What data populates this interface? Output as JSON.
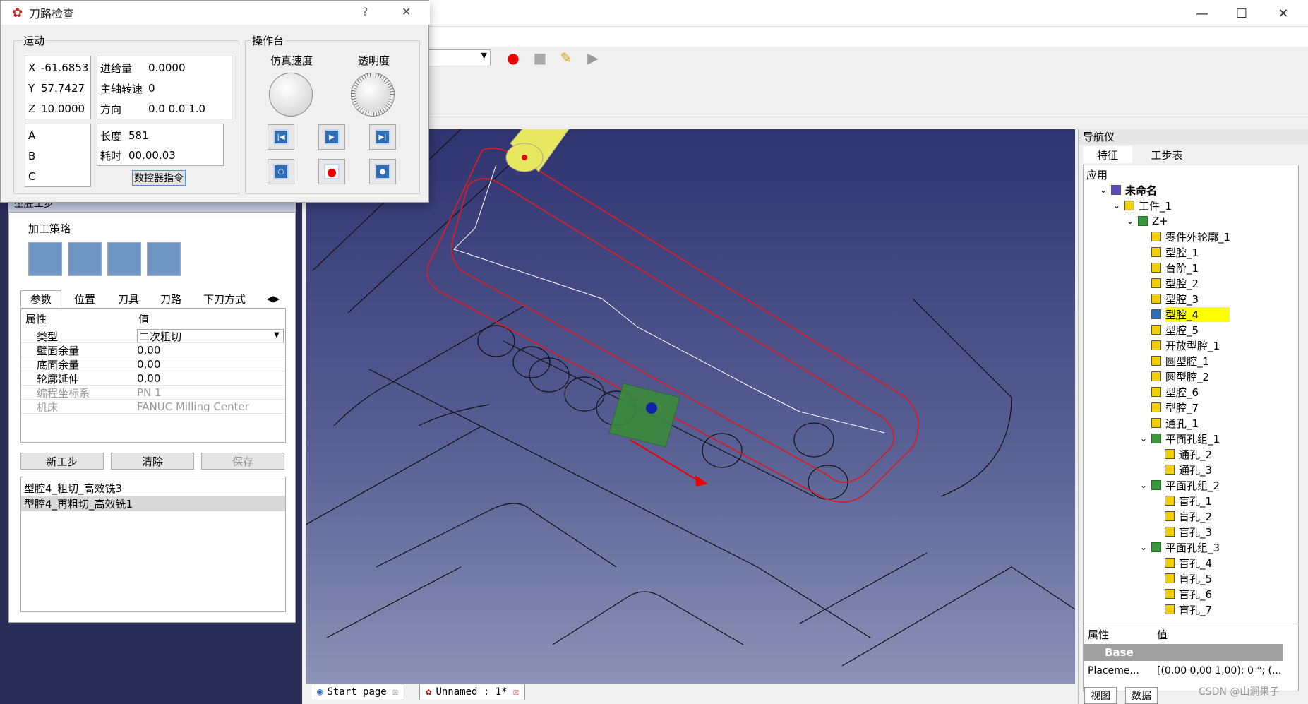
{
  "dialog": {
    "title": "刀路检查",
    "help": "?",
    "close": "✕",
    "motion": {
      "group_label": "运动",
      "x_label": "X",
      "x_value": "-61.6853",
      "y_label": "Y",
      "y_value": "57.7427",
      "z_label": "Z",
      "z_value": "10.0000",
      "a_label": "A",
      "b_label": "B",
      "c_label": "C",
      "feed_label": "进给量",
      "feed_value": "0.0000",
      "spindle_label": "主轴转速",
      "spindle_value": "0",
      "dir_label": "方向",
      "dir_value": "0.0 0.0 1.0",
      "length_label": "长度",
      "length_value": "581",
      "time_label": "耗时",
      "time_value": "00.00.03",
      "nc_button": "数控器指令"
    },
    "console": {
      "group_label": "操作台",
      "speed_label": "仿真速度",
      "opacity_label": "透明度"
    }
  },
  "window": {
    "minimize": "—",
    "maximize": "☐",
    "close": "✕"
  },
  "left_panel": {
    "header": "型腔工步",
    "strategy_label": "加工策略",
    "tabs": [
      "参数",
      "位置",
      "刀具",
      "刀路",
      "下刀方式"
    ],
    "prop_header": "属性",
    "value_header": "值",
    "props": [
      {
        "name": "类型",
        "value": "二次粗切",
        "disabled": false
      },
      {
        "name": "壁面余量",
        "value": "0,00",
        "disabled": false
      },
      {
        "name": "底面余量",
        "value": "0,00",
        "disabled": false
      },
      {
        "name": "轮廓延伸",
        "value": "0,00",
        "disabled": false
      },
      {
        "name": "编程坐标系",
        "value": "PN 1",
        "disabled": true
      },
      {
        "name": "机床",
        "value": "FANUC Milling Center",
        "disabled": true
      }
    ],
    "new_button": "新工步",
    "clear_button": "清除",
    "save_button": "保存",
    "steps": [
      "型腔4_粗切_高效铣3",
      "型腔4_再粗切_高效铣1"
    ]
  },
  "navigator": {
    "title": "导航仪",
    "tab_feature": "特征",
    "tab_steps": "工步表",
    "tree": [
      {
        "label": "应用",
        "level": 0,
        "arrow": ""
      },
      {
        "label": "未命名",
        "level": 1,
        "arrow": "v"
      },
      {
        "label": "工件_1",
        "level": 2,
        "arrow": "v"
      },
      {
        "label": "Z+",
        "level": 3,
        "arrow": "v"
      },
      {
        "label": "零件外轮廓_1",
        "level": 4,
        "arrow": ""
      },
      {
        "label": "型腔_1",
        "level": 4,
        "arrow": ""
      },
      {
        "label": "台阶_1",
        "level": 4,
        "arrow": ""
      },
      {
        "label": "型腔_2",
        "level": 4,
        "arrow": ""
      },
      {
        "label": "型腔_3",
        "level": 4,
        "arrow": ""
      },
      {
        "label": "型腔_4",
        "level": 4,
        "arrow": "",
        "selected": true
      },
      {
        "label": "型腔_5",
        "level": 4,
        "arrow": ""
      },
      {
        "label": "开放型腔_1",
        "level": 4,
        "arrow": ""
      },
      {
        "label": "圆型腔_1",
        "level": 4,
        "arrow": ""
      },
      {
        "label": "圆型腔_2",
        "level": 4,
        "arrow": ""
      },
      {
        "label": "型腔_6",
        "level": 4,
        "arrow": ""
      },
      {
        "label": "型腔_7",
        "level": 4,
        "arrow": ""
      },
      {
        "label": "通孔_1",
        "level": 4,
        "arrow": ""
      },
      {
        "label": "平面孔组_1",
        "level": 4,
        "arrow": "v"
      },
      {
        "label": "通孔_2",
        "level": 5,
        "arrow": ""
      },
      {
        "label": "通孔_3",
        "level": 5,
        "arrow": ""
      },
      {
        "label": "平面孔组_2",
        "level": 4,
        "arrow": "v"
      },
      {
        "label": "盲孔_1",
        "level": 5,
        "arrow": ""
      },
      {
        "label": "盲孔_2",
        "level": 5,
        "arrow": ""
      },
      {
        "label": "盲孔_3",
        "level": 5,
        "arrow": ""
      },
      {
        "label": "平面孔组_3",
        "level": 4,
        "arrow": "v"
      },
      {
        "label": "盲孔_4",
        "level": 5,
        "arrow": ""
      },
      {
        "label": "盲孔_5",
        "level": 5,
        "arrow": ""
      },
      {
        "label": "盲孔_6",
        "level": 5,
        "arrow": ""
      },
      {
        "label": "盲孔_7",
        "level": 5,
        "arrow": ""
      }
    ],
    "pgrid": {
      "prop_header": "属性",
      "value_header": "值",
      "section": "Base",
      "row_name": "Placeme...",
      "row_value": "[(0,00 0,00 1,00); 0 °; (..."
    },
    "bottom_tab_view": "视图",
    "bottom_tab_data": "数据"
  },
  "doc_tabs": {
    "start": "Start page",
    "unnamed": "Unnamed : 1*"
  },
  "watermark": "CSDN @山涧果子",
  "colors": {
    "selected_row": "#ffff00",
    "viewport_top": "#2f3370",
    "toolpath": "#d0202a"
  }
}
